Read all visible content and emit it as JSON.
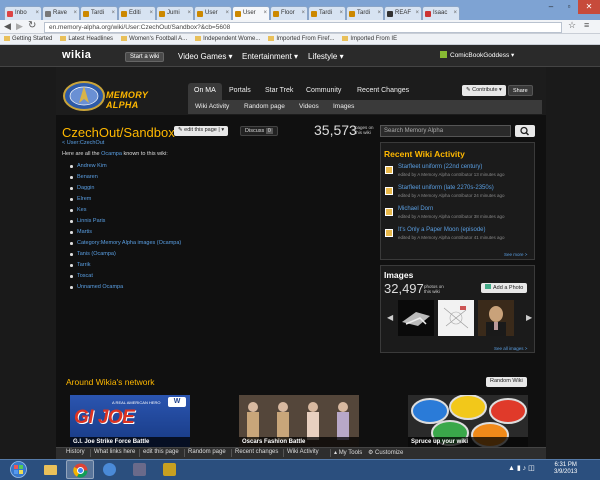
{
  "browser": {
    "tabs": [
      {
        "label": "Inbo",
        "color": "#d44"
      },
      {
        "label": "Rave",
        "color": "#777"
      },
      {
        "label": "Tardi",
        "color": "#c80"
      },
      {
        "label": "Editi",
        "color": "#c80"
      },
      {
        "label": "Jumi",
        "color": "#c80"
      },
      {
        "label": "User",
        "color": "#c80"
      },
      {
        "label": "User",
        "color": "#c80",
        "active": true
      },
      {
        "label": "Floor",
        "color": "#c80"
      },
      {
        "label": "Tardi",
        "color": "#c80"
      },
      {
        "label": "Tardi",
        "color": "#c80"
      },
      {
        "label": "REAF",
        "color": "#333"
      },
      {
        "label": "Isaac",
        "color": "#c33"
      }
    ],
    "url": "en.memory-alpha.org/wiki/User:CzechOut/Sandbox?&cb=5608",
    "bookmarks": [
      "Getting Started",
      "Latest Headlines",
      "Women's Football A...",
      "Independent Wome...",
      "Imported From Firef...",
      "Imported From IE"
    ]
  },
  "wikia": {
    "logo": "wikia",
    "start_wiki": "Start a wiki",
    "nav": [
      "Video Games",
      "Entertainment",
      "Lifestyle"
    ],
    "username": "ComicBookGoddess"
  },
  "wiki": {
    "logo_text": "MEMORY ALPHA",
    "tabs": [
      "On MA",
      "Portals",
      "Star Trek",
      "Community",
      "Recent Changes"
    ],
    "subnav": [
      "Wiki Activity",
      "Random page",
      "Videos",
      "Images"
    ],
    "contribute": "Contribute",
    "share": "Share"
  },
  "article": {
    "title": "CzechOut/Sandbox",
    "edit": "edit this page",
    "discuss": "Discuss",
    "discuss_count": "0",
    "backlink": "< User:CzechOut",
    "intro_before": "Here are all the ",
    "intro_link": "Ocampa",
    "intro_after": " known to this wiki:",
    "links": [
      "Andrew Kim",
      "Benaren",
      "Daggin",
      "Elrem",
      "Kes",
      "Linnis Paris",
      "Martis",
      "Category:Memory Alpha images (Ocampa)",
      "Tanis (Ocampa)",
      "Tarrik",
      "Toscat",
      "Unnamed Ocampa"
    ]
  },
  "rail": {
    "page_count": "35,573",
    "page_count_label1": "pages on",
    "page_count_label2": "this wiki",
    "search_placeholder": "Search Memory Alpha",
    "activity_title": "Recent Wiki Activity",
    "activity": [
      {
        "title": "Starfleet uniform (22nd century)",
        "meta": "edited by A Memory Alpha contributor 13 minutes ago"
      },
      {
        "title": "Starfleet uniform (late 2270s-2350s)",
        "meta": "edited by A Memory Alpha contributor 24 minutes ago"
      },
      {
        "title": "Michael Dorn",
        "meta": "edited by A Memory Alpha contributor 38 minutes ago"
      },
      {
        "title": "It's Only a Paper Moon (episode)",
        "meta": "edited by A Memory Alpha contributor 41 minutes ago"
      }
    ],
    "see_more": "See more >",
    "images_title": "Images",
    "images_count": "32,497",
    "images_label1": "photos on",
    "images_label2": "this wiki",
    "add_photo": "Add a Photo",
    "see_all": "See all images >"
  },
  "around": {
    "title": "Around Wikia's network",
    "random": "Random Wiki",
    "promos": [
      {
        "caption": "G.I. Joe Strike Force Battle",
        "banner": "GI JOE",
        "small": "A REAL AMERICAN HERO"
      },
      {
        "caption": "Oscars Fashion Battle"
      },
      {
        "caption": "Spruce up your wiki"
      }
    ]
  },
  "toolbar": [
    "History",
    "What links here",
    "edit this page",
    "Random page",
    "Recent changes",
    "Wiki Activity",
    "My Tools",
    "Customize"
  ],
  "taskbar": {
    "time": "6:31 PM",
    "date": "3/9/2013"
  },
  "colors": {
    "accent": "#ffb800",
    "link": "#5a9fe3"
  }
}
